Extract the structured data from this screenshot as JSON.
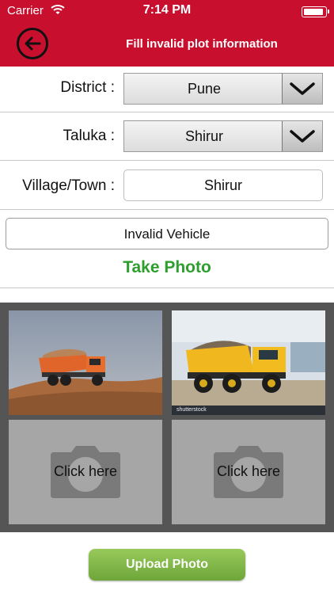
{
  "status_bar": {
    "carrier": "Carrier",
    "time": "7:14 PM"
  },
  "header": {
    "title": "Fill invalid plot information",
    "background": "#c8102e"
  },
  "form": {
    "district": {
      "label": "District :",
      "value": "Pune"
    },
    "taluka": {
      "label": "Taluka :",
      "value": "Shirur"
    },
    "village": {
      "label": "Village/Town :",
      "value": "Shirur"
    }
  },
  "vehicle_button": {
    "label": "Invalid Vehicle"
  },
  "take_photo": {
    "label": "Take Photo",
    "color": "#2e9e2e"
  },
  "photos": [
    {
      "type": "image",
      "subject": "orange dump truck on dirt mound"
    },
    {
      "type": "image",
      "subject": "yellow articulated dump truck",
      "watermark": "shutterstock"
    },
    {
      "type": "empty",
      "label": "Click here",
      "icon": "camera-icon"
    },
    {
      "type": "empty",
      "label": "Click here",
      "icon": "camera-icon"
    }
  ],
  "upload_button": {
    "label": "Upload Photo",
    "color": "#7db347"
  }
}
